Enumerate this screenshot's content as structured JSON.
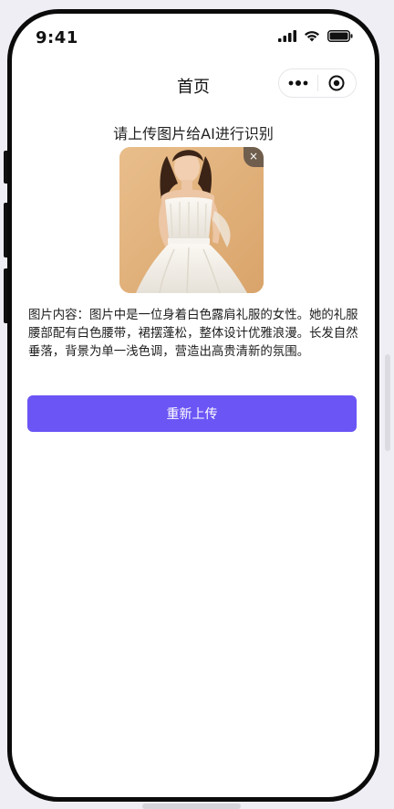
{
  "status_bar": {
    "time": "9:41",
    "icons": [
      "signal-icon",
      "wifi-icon",
      "battery-icon"
    ]
  },
  "nav": {
    "title": "首页",
    "capsule_icons": [
      "more-icon",
      "close-target-icon"
    ]
  },
  "upload": {
    "prompt": "请上传图片给AI进行识别",
    "remove_label": "×",
    "image_subject": "woman-in-white-dress-photo"
  },
  "result": {
    "text": "图片内容：图片中是一位身着白色露肩礼服的女性。她的礼服腰部配有白色腰带，裙摆蓬松，整体设计优雅浪漫。长发自然垂落，背景为单一浅色调，营造出高贵清新的氛围。"
  },
  "actions": {
    "reupload_label": "重新上传"
  },
  "colors": {
    "accent": "#6b55f5",
    "background": "#efeef4",
    "frame": "#0b0b0b"
  }
}
